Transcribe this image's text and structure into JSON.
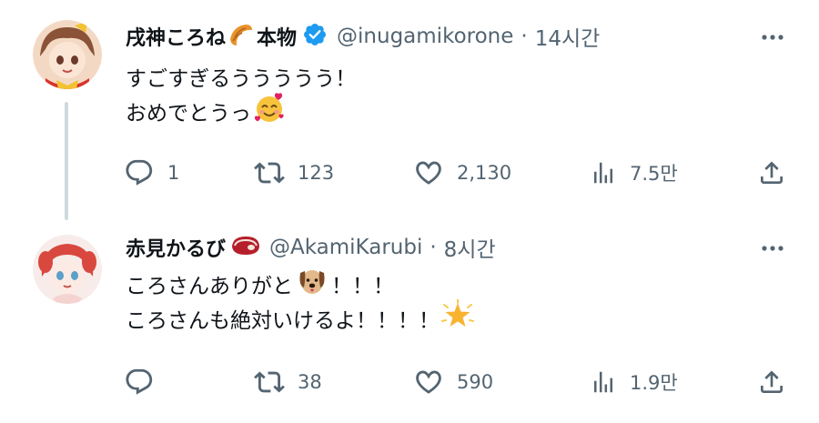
{
  "tweets": [
    {
      "name_prefix": "戌神ころね",
      "name_suffix": "本物",
      "name_emoji": "croissant-icon",
      "verified": true,
      "handle": "@inugamikorone",
      "separator": "·",
      "time": "14시간",
      "lines": [
        "すごすぎるううううう！",
        "おめでとうっ"
      ],
      "line_emojis": [
        "",
        "smiling-face-with-hearts-icon"
      ],
      "replies": "1",
      "retweets": "123",
      "likes": "2,130",
      "views": "7.5만"
    },
    {
      "name_prefix": "赤見かるび",
      "name_emoji": "meat-icon",
      "verified": false,
      "handle": "@AkamiKarubi",
      "separator": "·",
      "time": "8시간",
      "lines": [
        "ころさんありがと",
        "ころさんも絶対いけるよ！！！！"
      ],
      "line2_mid": "！！！",
      "line_emojis": [
        "dog-face-icon",
        "glowing-star-icon"
      ],
      "replies": "",
      "retweets": "38",
      "likes": "590",
      "views": "1.9만"
    }
  ],
  "colors": {
    "text": "#0f1419",
    "secondary": "#536471",
    "verified": "#1d9bf0",
    "thread_line": "#cfd9de"
  }
}
